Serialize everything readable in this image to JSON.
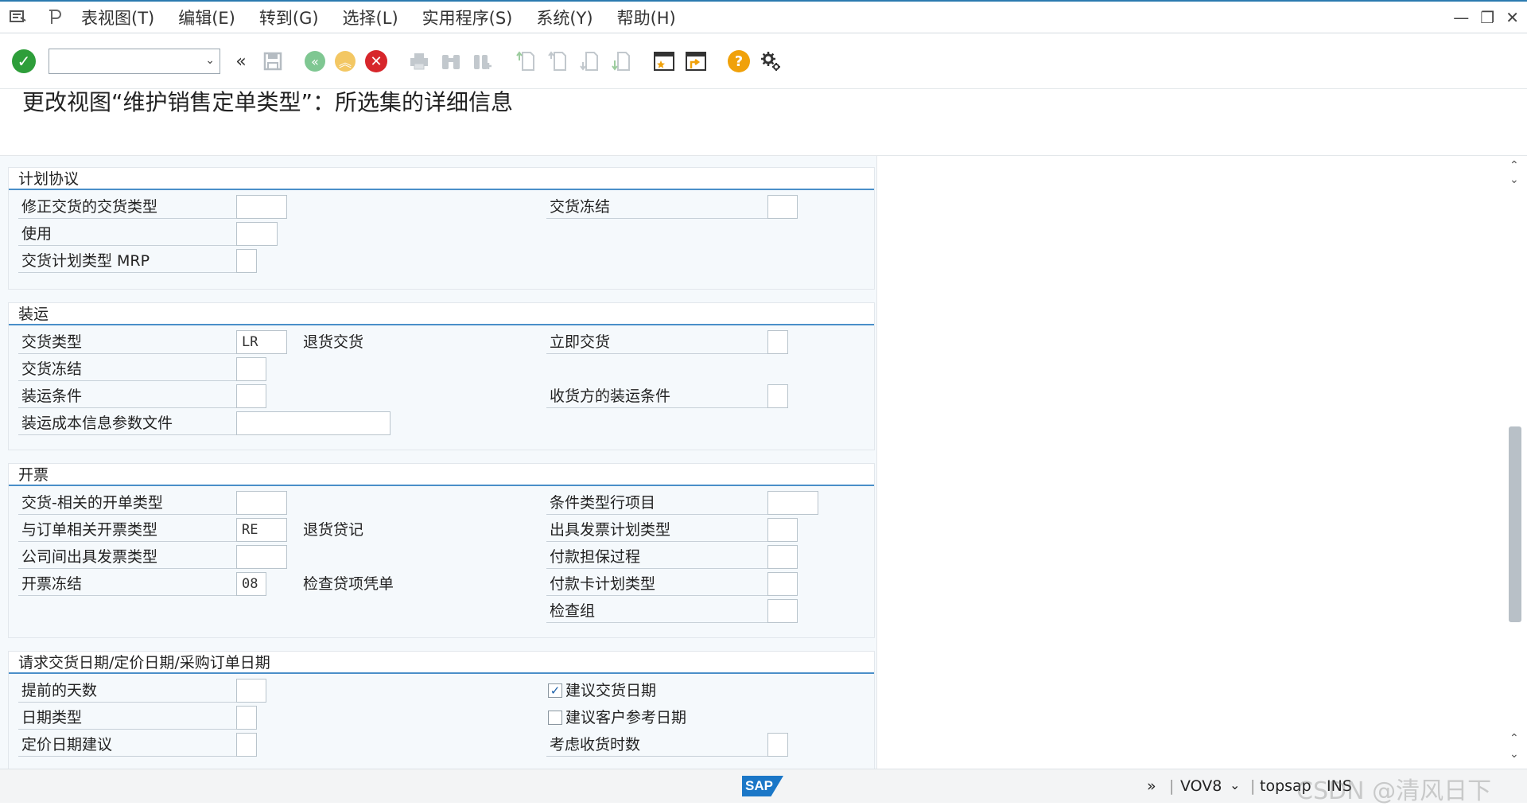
{
  "menu": {
    "items": [
      "表视图(T)",
      "编辑(E)",
      "转到(G)",
      "选择(L)",
      "实用程序(S)",
      "系统(Y)",
      "帮助(H)"
    ]
  },
  "toolbar": {
    "command_value": "",
    "icons": [
      "enter-icon",
      "back-double-icon",
      "save-icon",
      "back-icon",
      "exit-icon",
      "cancel-icon",
      "print-icon",
      "find-icon",
      "find-next-icon",
      "first-page-icon",
      "prev-page-icon",
      "next-page-icon",
      "last-page-icon",
      "create-session-icon",
      "shortcut-icon",
      "help-icon",
      "settings-icon"
    ]
  },
  "page_title": "更改视图“维护销售定单类型”：所选集的详细信息",
  "groups": {
    "planning": {
      "title": "计划协议",
      "fields": {
        "corr_delivery_type": {
          "label": "修正交货的交货类型",
          "value": ""
        },
        "usage": {
          "label": "使用",
          "value": ""
        },
        "mrp_delivery_schedule": {
          "label": "交货计划类型 MRP",
          "value": ""
        },
        "delivery_block": {
          "label": "交货冻结",
          "value": ""
        }
      }
    },
    "shipping": {
      "title": "装运",
      "fields": {
        "delivery_type": {
          "label": "交货类型",
          "value": "LR",
          "desc": "退货交货"
        },
        "immediate_delivery": {
          "label": "立即交货",
          "value": ""
        },
        "delivery_block": {
          "label": "交货冻结",
          "value": ""
        },
        "shipping_conditions": {
          "label": "装运条件",
          "value": ""
        },
        "ship_to_conditions": {
          "label": "收货方的装运条件",
          "value": ""
        },
        "shipment_cost_profile": {
          "label": "装运成本信息参数文件",
          "value": ""
        }
      }
    },
    "billing": {
      "title": "开票",
      "fields": {
        "delivery_billing_type": {
          "label": "交货-相关的开单类型",
          "value": ""
        },
        "cond_type_line_items": {
          "label": "条件类型行项目",
          "value": ""
        },
        "order_billing_type": {
          "label": "与订单相关开票类型",
          "value": "RE",
          "desc": "退货贷记"
        },
        "billing_plan_type": {
          "label": "出具发票计划类型",
          "value": ""
        },
        "intercompany_billing_type": {
          "label": "公司间出具发票类型",
          "value": ""
        },
        "payment_guarantee": {
          "label": "付款担保过程",
          "value": ""
        },
        "billing_block": {
          "label": "开票冻结",
          "value": "08",
          "desc": "检查贷项凭单"
        },
        "payment_card_plan": {
          "label": "付款卡计划类型",
          "value": ""
        },
        "checking_group": {
          "label": "检查组",
          "value": ""
        }
      }
    },
    "dates": {
      "title": "请求交货日期/定价日期/采购订单日期",
      "fields": {
        "lead_time_days": {
          "label": "提前的天数",
          "value": ""
        },
        "propose_delivery_date": {
          "label": "建议交货日期",
          "checked": true
        },
        "date_type": {
          "label": "日期类型",
          "value": ""
        },
        "propose_cust_ref_date": {
          "label": "建议客户参考日期",
          "checked": false
        },
        "pricing_date_proposal": {
          "label": "定价日期建议",
          "value": ""
        },
        "consider_receiving_times": {
          "label": "考虑收货时数",
          "value": ""
        }
      }
    }
  },
  "status": {
    "transaction": "VOV8",
    "system": "topsap",
    "mode": "INS",
    "watermark": "CSDN @清风日下"
  }
}
